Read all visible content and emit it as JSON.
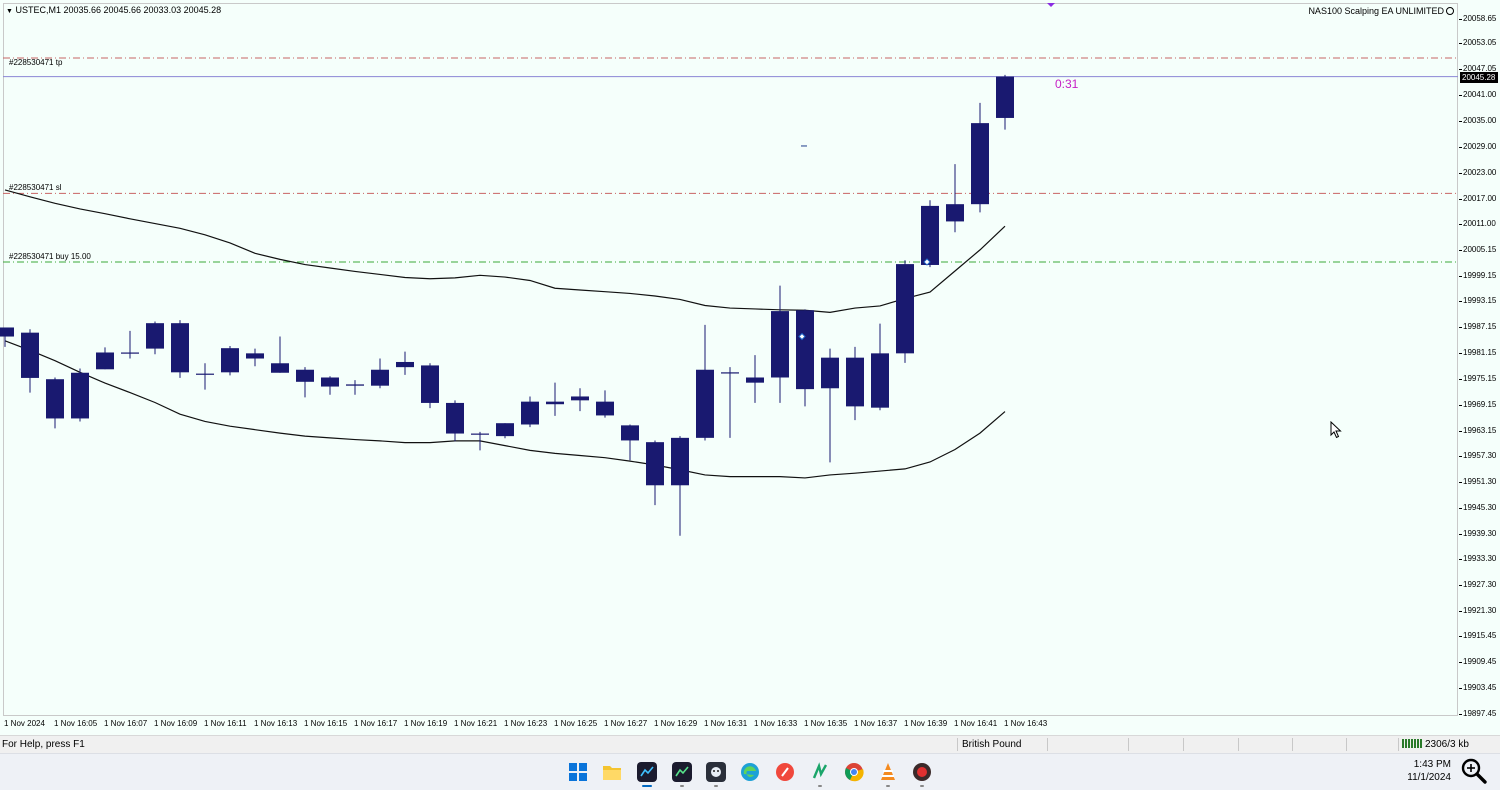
{
  "chart_data": {
    "type": "candlestick",
    "symbol_header": "USTEC,M1  20035.66 20045.66 20033.03 20045.28",
    "ea_label": "NAS100 Scalping EA UNLIMITED",
    "countdown": "0:31",
    "current_price": "20045.28",
    "y_ticks": [
      "20058.65",
      "20053.05",
      "20047.05",
      "20041.00",
      "20035.00",
      "20029.00",
      "20023.00",
      "20017.00",
      "20011.00",
      "20005.15",
      "19999.15",
      "19993.15",
      "19987.15",
      "19981.15",
      "19975.15",
      "19969.15",
      "19963.15",
      "19957.30",
      "19951.30",
      "19945.30",
      "19939.30",
      "19933.30",
      "19927.30",
      "19921.30",
      "19915.45",
      "19909.45",
      "19903.45",
      "19897.45"
    ],
    "x_ticks": [
      "1 Nov 2024",
      "1 Nov 16:05",
      "1 Nov 16:07",
      "1 Nov 16:09",
      "1 Nov 16:11",
      "1 Nov 16:13",
      "1 Nov 16:15",
      "1 Nov 16:17",
      "1 Nov 16:19",
      "1 Nov 16:21",
      "1 Nov 16:23",
      "1 Nov 16:25",
      "1 Nov 16:27",
      "1 Nov 16:29",
      "1 Nov 16:31",
      "1 Nov 16:33",
      "1 Nov 16:35",
      "1 Nov 16:37",
      "1 Nov 16:39",
      "1 Nov 16:41",
      "1 Nov 16:43"
    ],
    "trade_lines": [
      {
        "label": "#228530471 tp",
        "price": 20049.6,
        "color": "#c86464",
        "style": "dash-dot"
      },
      {
        "label": "#228530471 sl",
        "price": 20018.2,
        "color": "#c86464",
        "style": "dash-dot"
      },
      {
        "label": "#228530471 buy 15.00",
        "price": 20002.3,
        "color": "#3aa83a",
        "style": "dash-dot"
      }
    ],
    "candle_color": "#191970",
    "candles": [
      {
        "o": 19985.0,
        "h": 19987.1,
        "l": 19982.6,
        "c": 19987.1
      },
      {
        "o": 19975.4,
        "h": 19986.7,
        "l": 19972.0,
        "c": 19985.9
      },
      {
        "o": 19975.1,
        "h": 19975.5,
        "l": 19963.7,
        "c": 19966.0
      },
      {
        "o": 19966.0,
        "h": 19977.6,
        "l": 19965.3,
        "c": 19976.6
      },
      {
        "o": 19977.4,
        "h": 19982.5,
        "l": 19977.4,
        "c": 19981.3
      },
      {
        "o": 19981.3,
        "h": 19986.3,
        "l": 19979.9,
        "c": 19981.1
      },
      {
        "o": 19982.2,
        "h": 19988.5,
        "l": 19980.9,
        "c": 19988.1
      },
      {
        "o": 19976.7,
        "h": 19988.8,
        "l": 19975.4,
        "c": 19988.1
      },
      {
        "o": 19976.4,
        "h": 19978.8,
        "l": 19972.7,
        "c": 19976.4
      },
      {
        "o": 19976.7,
        "h": 19982.8,
        "l": 19976.0,
        "c": 19982.3
      },
      {
        "o": 19981.1,
        "h": 19982.2,
        "l": 19978.1,
        "c": 19979.9
      },
      {
        "o": 19978.8,
        "h": 19985.0,
        "l": 19976.6,
        "c": 19976.6
      },
      {
        "o": 19974.5,
        "h": 19977.9,
        "l": 19970.9,
        "c": 19977.3
      },
      {
        "o": 19973.4,
        "h": 19975.8,
        "l": 19971.5,
        "c": 19975.5
      },
      {
        "o": 19973.6,
        "h": 19974.9,
        "l": 19971.5,
        "c": 19973.9
      },
      {
        "o": 19973.6,
        "h": 19979.9,
        "l": 19973.0,
        "c": 19977.3
      },
      {
        "o": 19979.1,
        "h": 19981.5,
        "l": 19976.1,
        "c": 19977.9
      },
      {
        "o": 19978.3,
        "h": 19978.8,
        "l": 19968.4,
        "c": 19969.6
      },
      {
        "o": 19969.6,
        "h": 19970.2,
        "l": 19960.7,
        "c": 19962.5
      },
      {
        "o": 19962.5,
        "h": 19962.9,
        "l": 19958.6,
        "c": 19962.5
      },
      {
        "o": 19961.9,
        "h": 19964.9,
        "l": 19961.4,
        "c": 19964.9
      },
      {
        "o": 19964.6,
        "h": 19971.1,
        "l": 19964.0,
        "c": 19969.9
      },
      {
        "o": 19969.3,
        "h": 19974.3,
        "l": 19966.6,
        "c": 19969.9
      },
      {
        "o": 19970.2,
        "h": 19973.0,
        "l": 19967.7,
        "c": 19971.1
      },
      {
        "o": 19969.9,
        "h": 19972.5,
        "l": 19966.2,
        "c": 19966.7
      },
      {
        "o": 19964.4,
        "h": 19964.6,
        "l": 19956.3,
        "c": 19960.9
      },
      {
        "o": 19960.5,
        "h": 19960.9,
        "l": 19945.9,
        "c": 19950.5
      },
      {
        "o": 19950.5,
        "h": 19961.9,
        "l": 19938.8,
        "c": 19961.5
      },
      {
        "o": 19961.5,
        "h": 19987.7,
        "l": 19960.9,
        "c": 19977.3
      },
      {
        "o": 19976.7,
        "h": 19977.9,
        "l": 19961.5,
        "c": 19976.7
      },
      {
        "o": 19975.5,
        "h": 19980.7,
        "l": 19969.6,
        "c": 19974.3
      },
      {
        "o": 19975.5,
        "h": 19996.8,
        "l": 19969.6,
        "c": 19990.9
      },
      {
        "o": 19991.1,
        "h": 19991.3,
        "l": 19968.8,
        "c": 19972.8
      },
      {
        "o": 19973.0,
        "h": 19982.2,
        "l": 19955.8,
        "c": 19980.1
      },
      {
        "o": 19980.1,
        "h": 19982.6,
        "l": 19965.6,
        "c": 19968.8
      },
      {
        "o": 19968.5,
        "h": 19988.0,
        "l": 19967.9,
        "c": 19981.1
      },
      {
        "o": 19981.1,
        "h": 20002.7,
        "l": 19978.9,
        "c": 20001.8
      },
      {
        "o": 20001.6,
        "h": 20016.6,
        "l": 20001.1,
        "c": 20015.3
      },
      {
        "o": 20011.7,
        "h": 20025.0,
        "l": 20009.2,
        "c": 20015.7
      },
      {
        "o": 20015.7,
        "h": 20039.2,
        "l": 20013.8,
        "c": 20034.5
      },
      {
        "o": 20035.7,
        "h": 20045.7,
        "l": 20033.0,
        "c": 20045.3
      }
    ],
    "band_upper": [
      20019.0,
      20017.4,
      20015.9,
      20014.6,
      20013.5,
      20012.3,
      20011.2,
      20010.1,
      20008.6,
      20006.7,
      20004.3,
      20002.9,
      20001.7,
      20000.9,
      20000.1,
      19999.4,
      19998.7,
      19998.4,
      19998.6,
      19999.2,
      19998.8,
      19998.0,
      19996.2,
      19995.8,
      19995.4,
      19995.0,
      19994.4,
      19993.6,
      19992.2,
      19991.6,
      19991.4,
      19991.2,
      19991.1,
      19990.6,
      19991.6,
      19992.1,
      19993.8,
      19995.3,
      20000.2,
      20005.1,
      20010.6
    ],
    "band_lower": [
      19984.0,
      19981.8,
      19979.4,
      19976.7,
      19974.2,
      19972.0,
      19969.7,
      19967.0,
      19965.3,
      19964.2,
      19963.4,
      19962.6,
      19961.9,
      19961.5,
      19961.1,
      19960.8,
      19960.4,
      19960.4,
      19960.8,
      19960.8,
      19959.7,
      19958.6,
      19957.9,
      19957.4,
      19956.9,
      19956.1,
      19955.2,
      19954.1,
      19952.9,
      19952.5,
      19952.5,
      19952.5,
      19952.2,
      19952.9,
      19953.3,
      19953.8,
      19954.3,
      19955.9,
      19958.8,
      19962.6,
      19967.6
    ],
    "buy_marker_price": 20002.3,
    "signal_dash_price": 20029.2
  },
  "status_bar": {
    "help": "For Help, press F1",
    "currency": "British Pound",
    "traffic": "2306/3 kb"
  },
  "taskbar": {
    "time": "1:43 PM",
    "date": "11/1/2024",
    "icons": [
      "windows-start-icon",
      "file-explorer-icon",
      "metatrader-icon",
      "metatrader-icon-2",
      "app-icon",
      "edge-icon",
      "app-red-icon",
      "app-green-icon",
      "chrome-icon",
      "vlc-icon",
      "recorder-icon"
    ]
  }
}
